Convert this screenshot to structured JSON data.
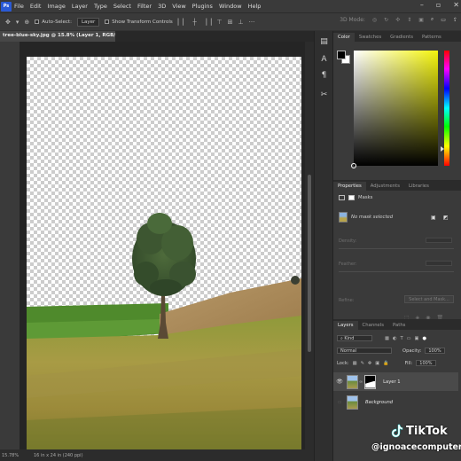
{
  "menubar": {
    "logo": "Ps",
    "items": [
      "File",
      "Edit",
      "Image",
      "Layer",
      "Type",
      "Select",
      "Filter",
      "3D",
      "View",
      "Plugins",
      "Window",
      "Help"
    ]
  },
  "options": {
    "auto_select_label": "Auto-Select:",
    "auto_select_target": "Layer",
    "transform_label": "Show Transform Controls",
    "mode_label": "3D Mode:"
  },
  "document": {
    "tab_title": "tree-blue-sky.jpg @ 15.8% (Layer 1, RGB/8) *",
    "zoom": "15.78%",
    "size": "16 in x 24 in (240 ppi)"
  },
  "color_panel": {
    "tabs": [
      "Color",
      "Swatches",
      "Gradients",
      "Patterns"
    ],
    "foreground": "#000000",
    "background": "#ffffff"
  },
  "properties_panel": {
    "tabs": [
      "Properties",
      "Adjustments",
      "Libraries"
    ],
    "section": "Masks",
    "mask_status": "No mask selected",
    "density_label": "Density:",
    "feather_label": "Feather:",
    "refine_label": "Refine:",
    "select_mask_button": "Select and Mask..."
  },
  "layers_panel": {
    "tabs": [
      "Layers",
      "Channels",
      "Paths"
    ],
    "filter_kind": "Kind",
    "blend_mode": "Normal",
    "opacity_label": "Opacity:",
    "opacity_value": "100%",
    "lock_label": "Lock:",
    "fill_label": "Fill:",
    "fill_value": "100%",
    "layers": [
      {
        "name": "Layer 1",
        "selected": true,
        "visible": true
      },
      {
        "name": "Background",
        "selected": false,
        "visible": false
      }
    ]
  },
  "watermark": {
    "brand": "TikTok",
    "user": "@ignoacecomputer"
  }
}
